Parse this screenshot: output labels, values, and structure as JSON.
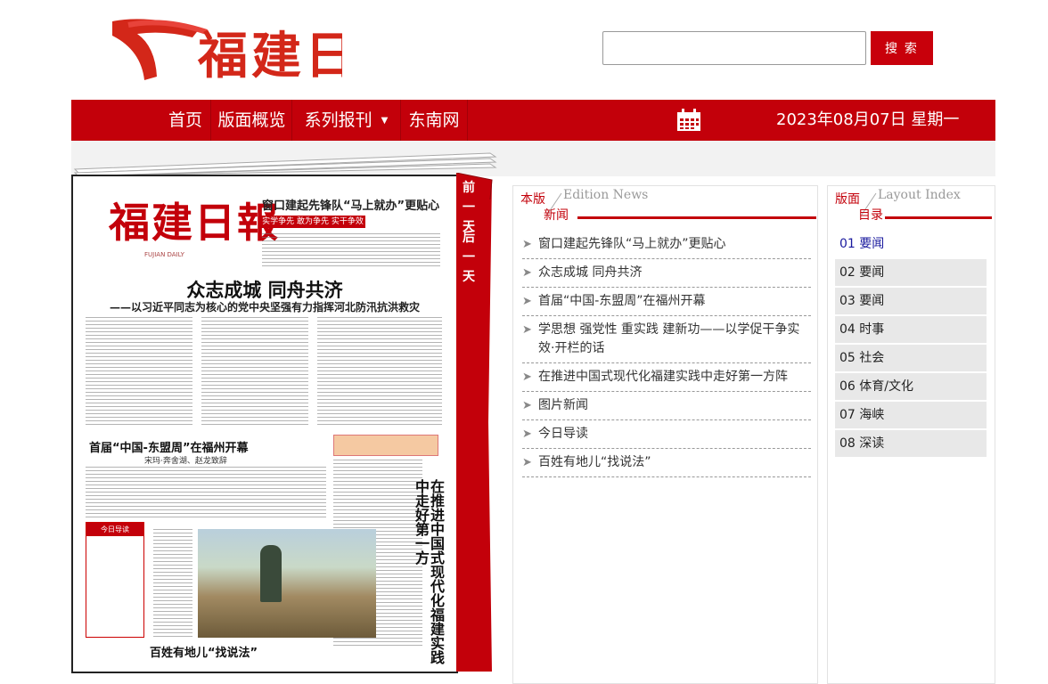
{
  "search": {
    "button_label": "搜 索",
    "value": ""
  },
  "nav": {
    "items": [
      "首页",
      "版面概览",
      "系列报刊",
      "东南网"
    ],
    "date": "2023年08月07日 星期一"
  },
  "ribbon": {
    "prev": "前一天",
    "next": "后一天"
  },
  "news_panel": {
    "head_cn_1": "本版",
    "head_cn_2": "新闻",
    "head_en": "Edition News",
    "items": [
      "窗口建起先锋队“马上就办”更贴心",
      "众志成城 同舟共济",
      "首届“中国-东盟周”在福州开幕",
      "学思想 强党性 重实践 建新功——以学促干争实效·开栏的话",
      "在推进中国式现代化福建实践中走好第一方阵",
      "图片新闻",
      "今日导读",
      "百姓有地儿“找说法”"
    ]
  },
  "index_panel": {
    "head_cn_1": "版面",
    "head_cn_2": "目录",
    "head_en": "Layout Index",
    "items": [
      "01 要闻",
      "02 要闻",
      "03 要闻",
      "04 时事",
      "05 社会",
      "06 体育/文化",
      "07 海峡",
      "08 深读"
    ]
  },
  "paper": {
    "masthead": "福建日報",
    "masthead_en": "FUJIAN DAILY",
    "top_headline": "窗口建起先锋队“马上就办”更贴心",
    "strip": "实学争先 敢为争先 实干争效",
    "headline_main": "众志成城 同舟共济",
    "headline_main_sub": "——以习近平同志为核心的党中央坚强有力指挥河北防汛抗洪救灾",
    "headline_2": "首届“中国-东盟周”在福州开幕",
    "headline_2_sub": "宋玛·奔舍湖、赵龙致辞",
    "headline_vertical": "在推进中国式现代化福建实践中走好第一方",
    "headline_3": "百姓有地儿“找说法”",
    "side_tag": "今日导读"
  },
  "colors": {
    "brand_red": "#c3000a",
    "link_blue": "#1a1a9e"
  }
}
